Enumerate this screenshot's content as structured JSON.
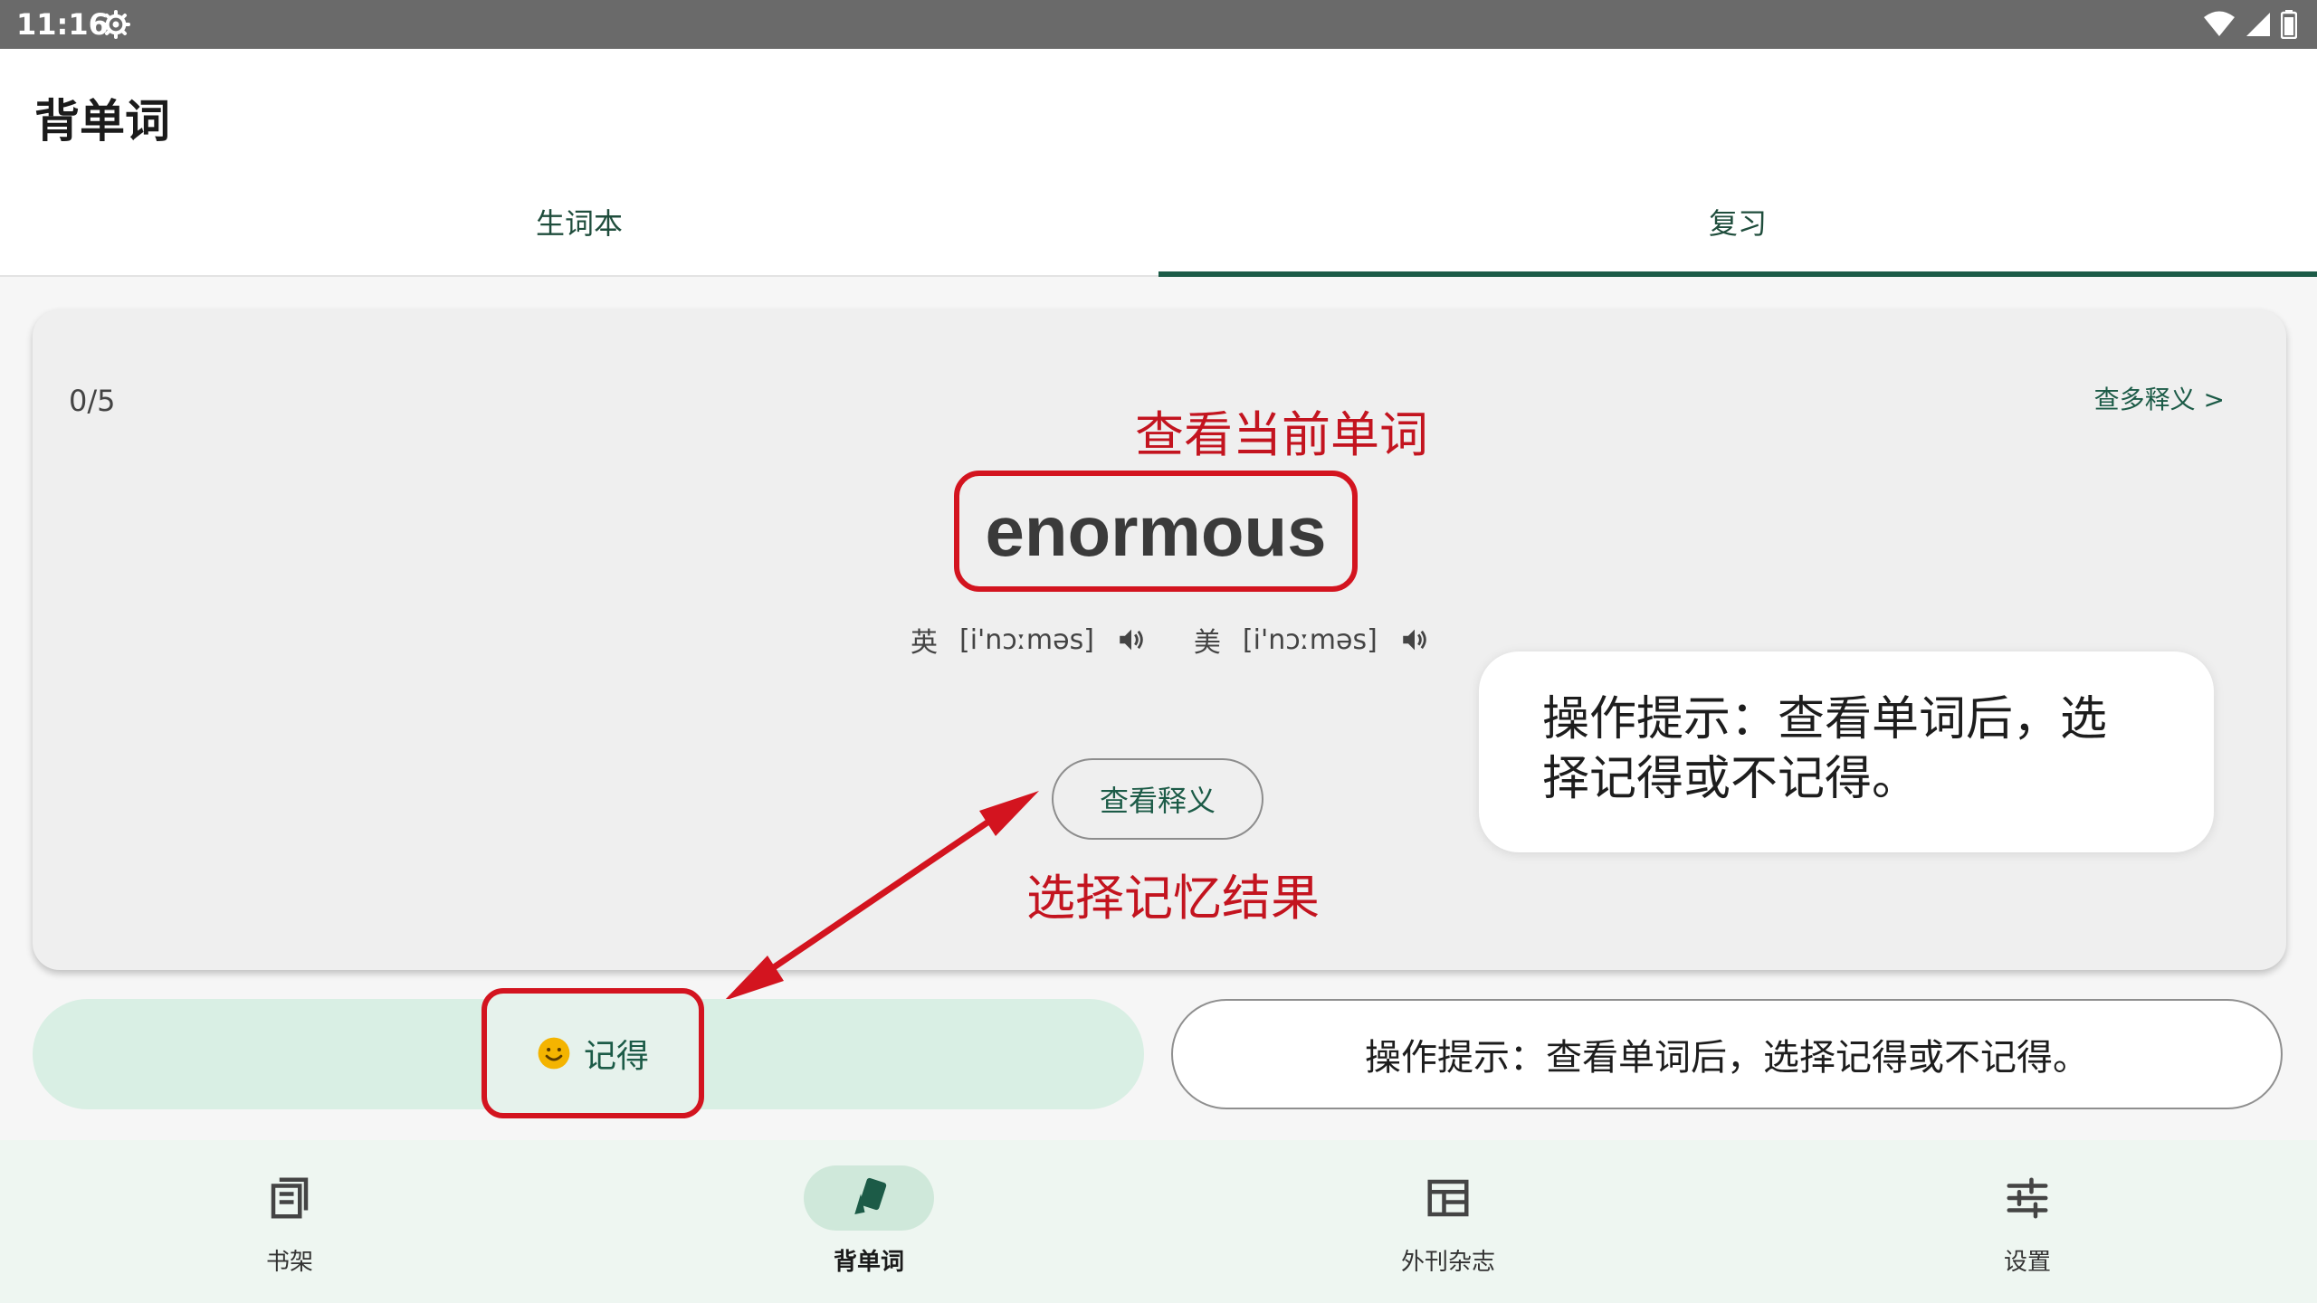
{
  "status_bar": {
    "time": "11:16"
  },
  "header": {
    "title": "背单词"
  },
  "tabs": [
    {
      "label": "生词本",
      "selected": false
    },
    {
      "label": "复习",
      "selected": true
    }
  ],
  "card": {
    "progress": "0/5",
    "more_meanings_link": "查多释义 >",
    "word": "enormous",
    "phonetics": {
      "uk_label": "英",
      "uk_ipa": "[i'nɔːməs]",
      "us_label": "美",
      "us_ipa": "[i'nɔːməs]"
    },
    "view_meaning_label": "查看释义"
  },
  "annotations": {
    "view_current_word": "查看当前单词",
    "choose_result": "选择记忆结果",
    "tip_bubble": "操作提示：查看单词后，选择记得或不记得。"
  },
  "actions": {
    "remember_label": "记得",
    "tip_pill": "操作提示：查看单词后，选择记得或不记得。"
  },
  "bottom_nav": [
    {
      "label": "书架",
      "icon": "bookshelf-icon",
      "selected": false
    },
    {
      "label": "背单词",
      "icon": "cards-icon",
      "selected": true
    },
    {
      "label": "外刊杂志",
      "icon": "magazine-icon",
      "selected": false
    },
    {
      "label": "设置",
      "icon": "settings-sliders-icon",
      "selected": false
    }
  ],
  "colors": {
    "accent": "#1c5b47",
    "annotation_red": "#d3141f",
    "remember_bar": "#d9efe4",
    "nav_bg": "#eef6f1"
  }
}
